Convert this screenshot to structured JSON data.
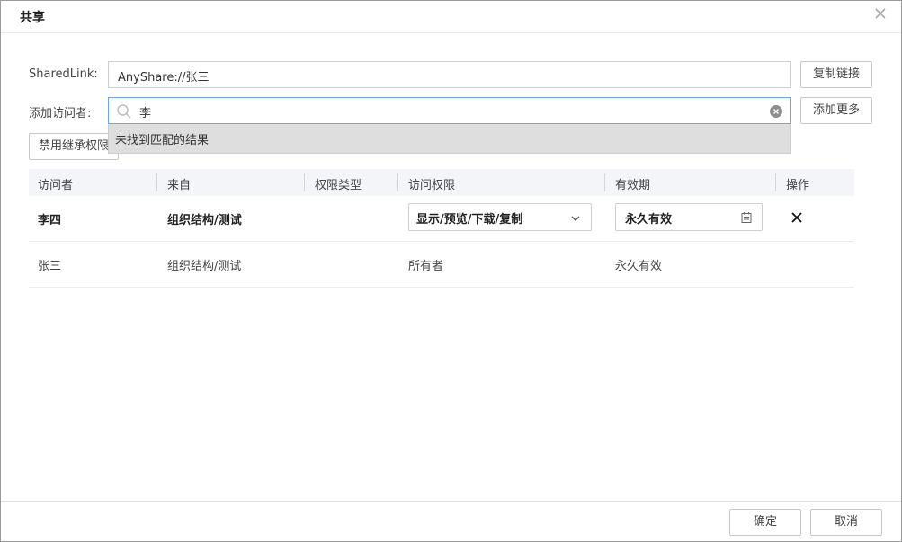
{
  "dialog": {
    "title": "共享",
    "close_icon": "close-icon"
  },
  "shared_link": {
    "label": "SharedLink:",
    "value": "AnyShare://张三",
    "copy_button": "复制链接"
  },
  "add_visitor": {
    "label": "添加访问者:",
    "search_value": "李",
    "no_result": "未找到匹配的结果",
    "add_more_button": "添加更多"
  },
  "inherit_button": "禁用继承权限",
  "table": {
    "headers": [
      "访问者",
      "来自",
      "权限类型",
      "访问权限",
      "有效期",
      "操作"
    ],
    "rows": [
      {
        "visitor": "李四",
        "from": "组织结构/测试",
        "type": "",
        "permission": "显示/预览/下载/复制",
        "validity": "永久有效",
        "editable": true
      },
      {
        "visitor": "张三",
        "from": "组织结构/测试",
        "type": "",
        "permission": "所有者",
        "validity": "永久有效",
        "editable": false
      }
    ]
  },
  "footer": {
    "ok_button": "确定",
    "cancel_button": "取消"
  },
  "colors": {
    "accent_border": "#6fa8dc",
    "header_bg": "#f3f5f8",
    "dropdown_bg": "#dedede"
  }
}
